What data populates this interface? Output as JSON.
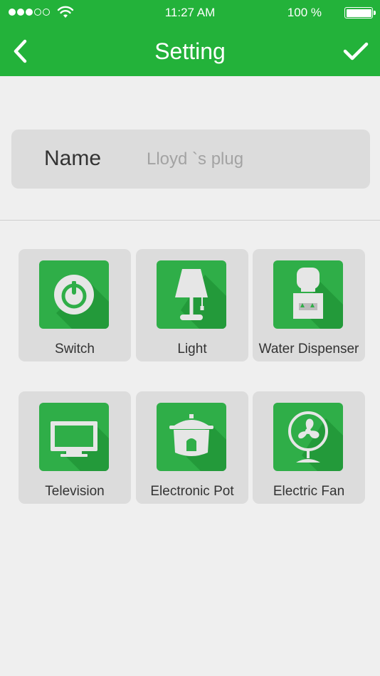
{
  "status_bar": {
    "time": "11:27 AM",
    "battery": "100 %",
    "signal_icon": "signal-dots-icon",
    "wifi_icon": "wifi-icon",
    "battery_icon": "battery-icon",
    "battery_level_percent": 100
  },
  "header": {
    "title": "Setting",
    "back_icon": "chevron-left-icon",
    "confirm_icon": "checkmark-icon"
  },
  "name_field": {
    "label": "Name",
    "placeholder": "Lloyd `s plug",
    "value": ""
  },
  "devices": [
    {
      "label": "Switch",
      "icon": "power-icon"
    },
    {
      "label": "Light",
      "icon": "lamp-icon"
    },
    {
      "label": "Water Dispenser",
      "icon": "water-dispenser-icon"
    },
    {
      "label": "Television",
      "icon": "television-icon"
    },
    {
      "label": "Electronic Pot",
      "icon": "rice-cooker-icon"
    },
    {
      "label": "Electric Fan",
      "icon": "fan-icon"
    }
  ],
  "colors": {
    "header": "#23b23a",
    "icon_tile": "#2fae48",
    "card": "#dcdcdc",
    "background": "#efefef"
  }
}
